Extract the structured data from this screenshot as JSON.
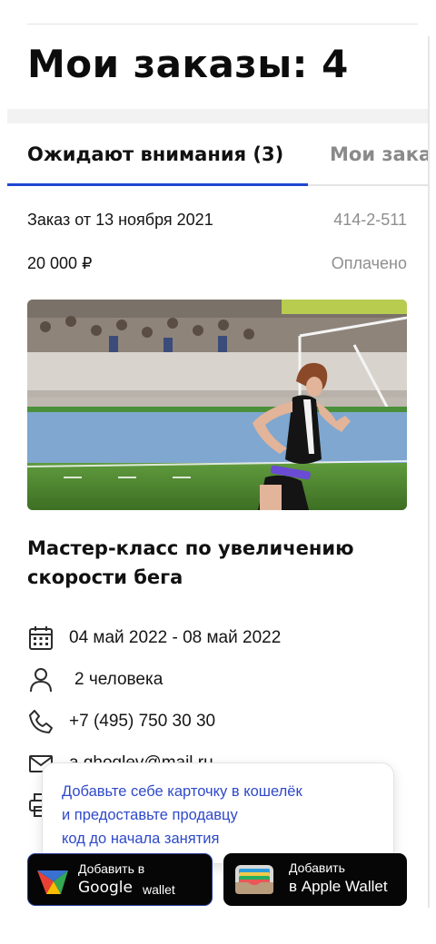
{
  "header": {
    "title": "Мои заказы: 4"
  },
  "tabs": [
    {
      "label": "Ожидают внимания (3)",
      "active": true
    },
    {
      "label": "Мои заказы",
      "active": false
    }
  ],
  "order": {
    "date_label": "Заказ от 13 ноября 2021",
    "number": "414-2-511",
    "price": "20 000 ₽",
    "status": "Оплачено"
  },
  "event": {
    "image": "runner-relay-baton-photo",
    "title": "Мастер-класс по увеличению скорости бега",
    "details": [
      {
        "icon": "calendar-icon",
        "text": "04 май 2022 - 08 май 2022"
      },
      {
        "icon": "person-icon",
        "text": "2 человека"
      },
      {
        "icon": "phone-icon",
        "text": "+7 (495) 750 30 30"
      },
      {
        "icon": "mail-icon",
        "text": "a.ghoglev@mail.ru"
      },
      {
        "icon": "printer-icon",
        "text": ""
      }
    ]
  },
  "wallet_popup": {
    "lines": [
      "Добавьте себе карточку в кошелёк",
      "и предоставьте продавцу",
      "код до начала занятия"
    ]
  },
  "wallet_buttons": {
    "google": {
      "small": "Добавить в",
      "big_main": "Google",
      "big_suffix": "wallet"
    },
    "apple": {
      "small": "Добавить",
      "big": "в Apple Wallet"
    }
  },
  "colors": {
    "accent": "#2046d3",
    "popup_text": "#2f49c9",
    "muted": "#8e8e8e",
    "wallet_bg": "#060606"
  }
}
